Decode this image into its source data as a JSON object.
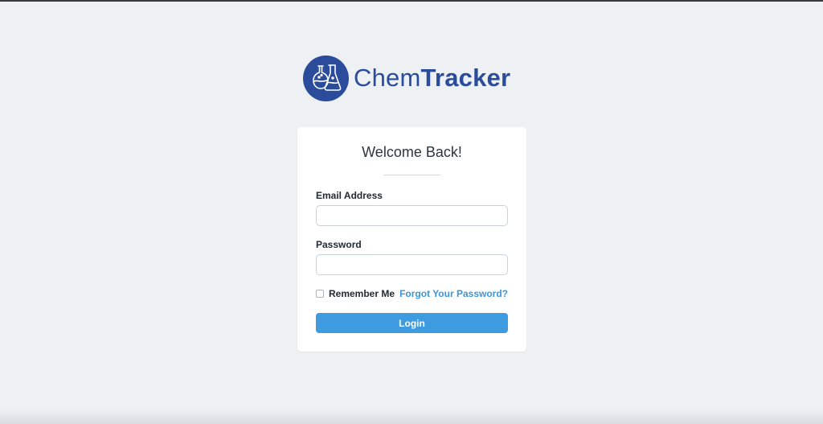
{
  "brand": {
    "name_part1": "Chem",
    "name_part2": "Tracker",
    "logo_icon": "flask-beakers-icon",
    "color": "#2b4c9b"
  },
  "login_card": {
    "title": "Welcome Back!",
    "email": {
      "label": "Email Address",
      "value": "",
      "placeholder": ""
    },
    "password": {
      "label": "Password",
      "value": "",
      "placeholder": ""
    },
    "remember_me": {
      "label": "Remember Me",
      "checked": false
    },
    "forgot_password_link": "Forgot Your Password?",
    "login_button": "Login"
  },
  "colors": {
    "accent": "#3e9be0",
    "link": "#3b95da",
    "background": "#eef1f3"
  }
}
